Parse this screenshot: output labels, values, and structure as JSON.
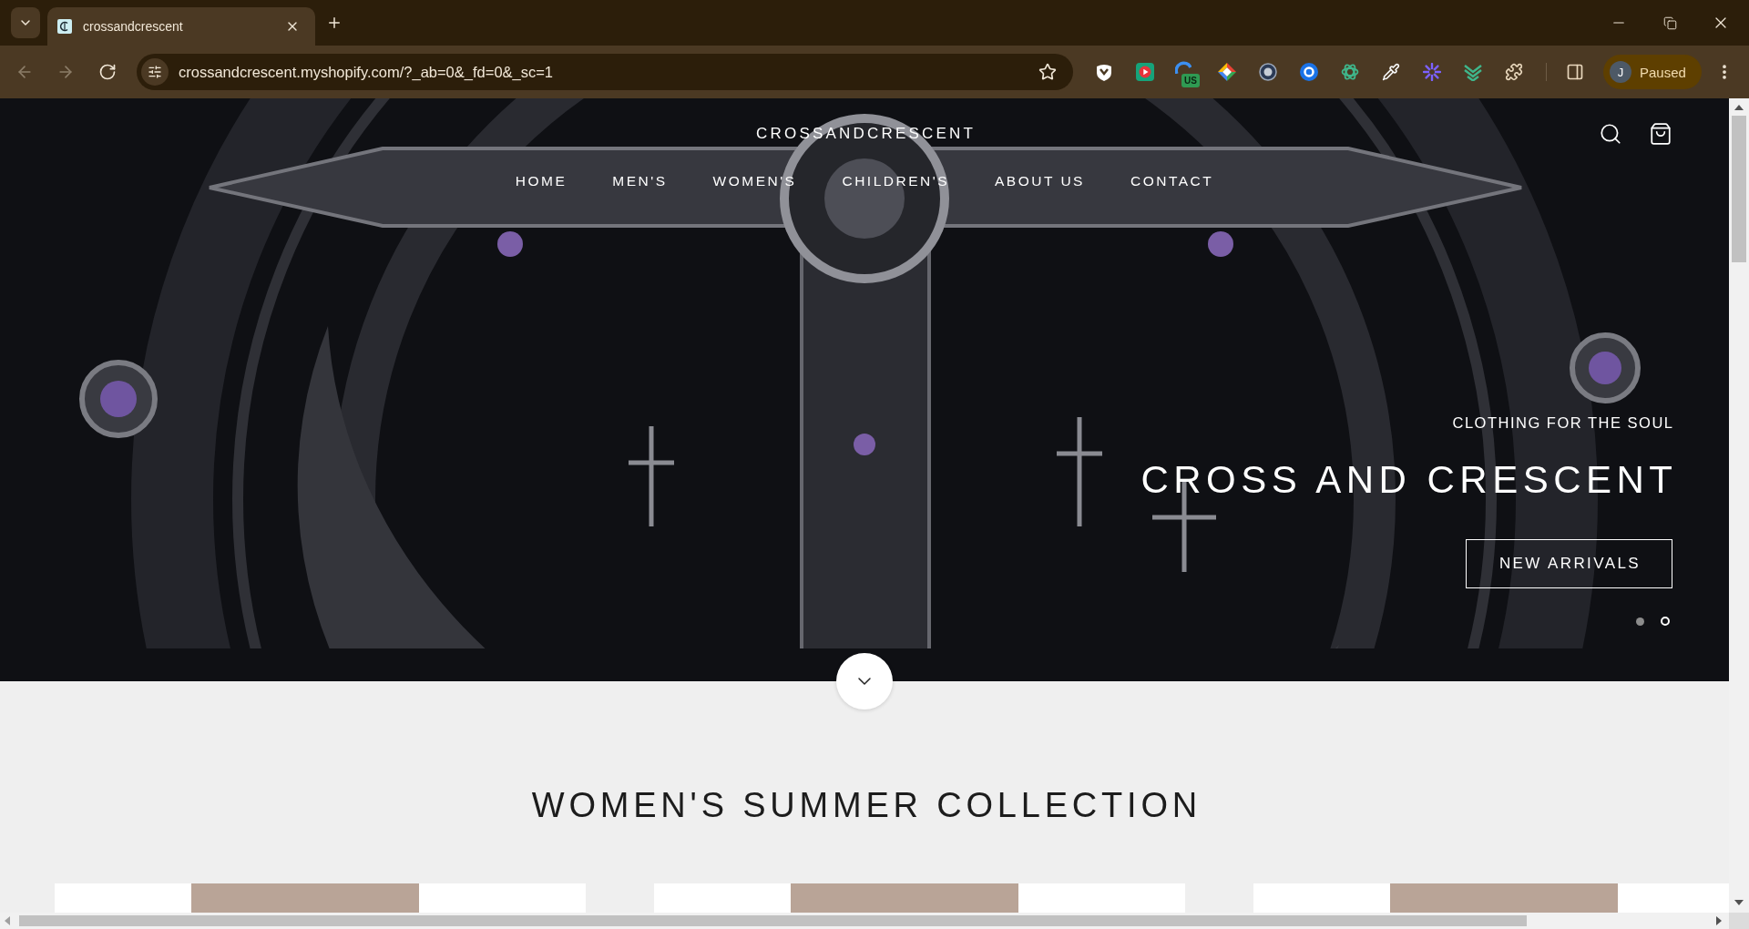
{
  "browser": {
    "tabs": [
      {
        "title": "crossandcrescent",
        "selected": true
      }
    ],
    "back": {
      "disabled": true
    },
    "forward": {
      "disabled": true
    },
    "address_bar": {
      "url": "crossandcrescent.myshopify.com/?_ab=0&_fd=0&_sc=1"
    },
    "extension_badge": "US",
    "profile": {
      "initial": "J",
      "status": "Paused"
    }
  },
  "header": {
    "logo": "CROSSANDCRESCENT",
    "nav": [
      {
        "label": "HOME"
      },
      {
        "label": "MEN'S"
      },
      {
        "label": "WOMEN'S"
      },
      {
        "label": "CHILDREN'S"
      },
      {
        "label": "ABOUT US"
      },
      {
        "label": "CONTACT"
      }
    ]
  },
  "hero": {
    "eyebrow": "CLOTHING FOR THE SOUL",
    "title": "CROSS AND CRESCENT",
    "button": "NEW ARRIVALS",
    "slides": [
      {
        "selected": false
      },
      {
        "selected": true
      }
    ]
  },
  "collection": {
    "title": "WOMEN'S SUMMER COLLECTION"
  }
}
